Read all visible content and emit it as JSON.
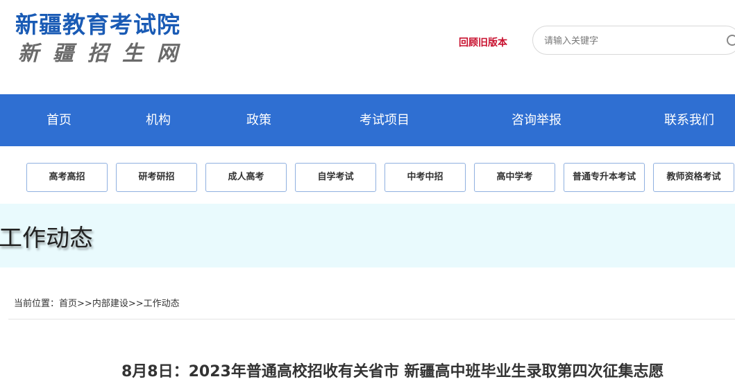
{
  "header": {
    "logo_main": "新疆教育考试院",
    "logo_sub": "新疆招生网",
    "old_version": "回顾旧版本",
    "search_placeholder": "请输入关键字",
    "search_icon": "search-icon"
  },
  "nav": {
    "items": [
      "首页",
      "机构",
      "政策",
      "考试项目",
      "咨询举报",
      "联系我们"
    ]
  },
  "categories": {
    "items": [
      "高考高招",
      "研考研招",
      "成人高考",
      "自学考试",
      "中考中招",
      "高中学考",
      "普通专升本考试",
      "教师资格考试"
    ]
  },
  "banner": {
    "title": "工作动态"
  },
  "breadcrumb": {
    "prefix": "当前位置：",
    "home": "首页",
    "sep1": ">>",
    "section": "内部建设",
    "sep2": ">>",
    "current": "工作动态"
  },
  "article": {
    "title": "8月8日：2023年普通高校招收有关省市 新疆高中班毕业生录取第四次征集志愿"
  },
  "colors": {
    "nav_bg": "#2f6fd2",
    "logo_blue": "#1a5bb5",
    "old_version_red": "#c8102e",
    "banner_bg": "#e9fafd"
  }
}
